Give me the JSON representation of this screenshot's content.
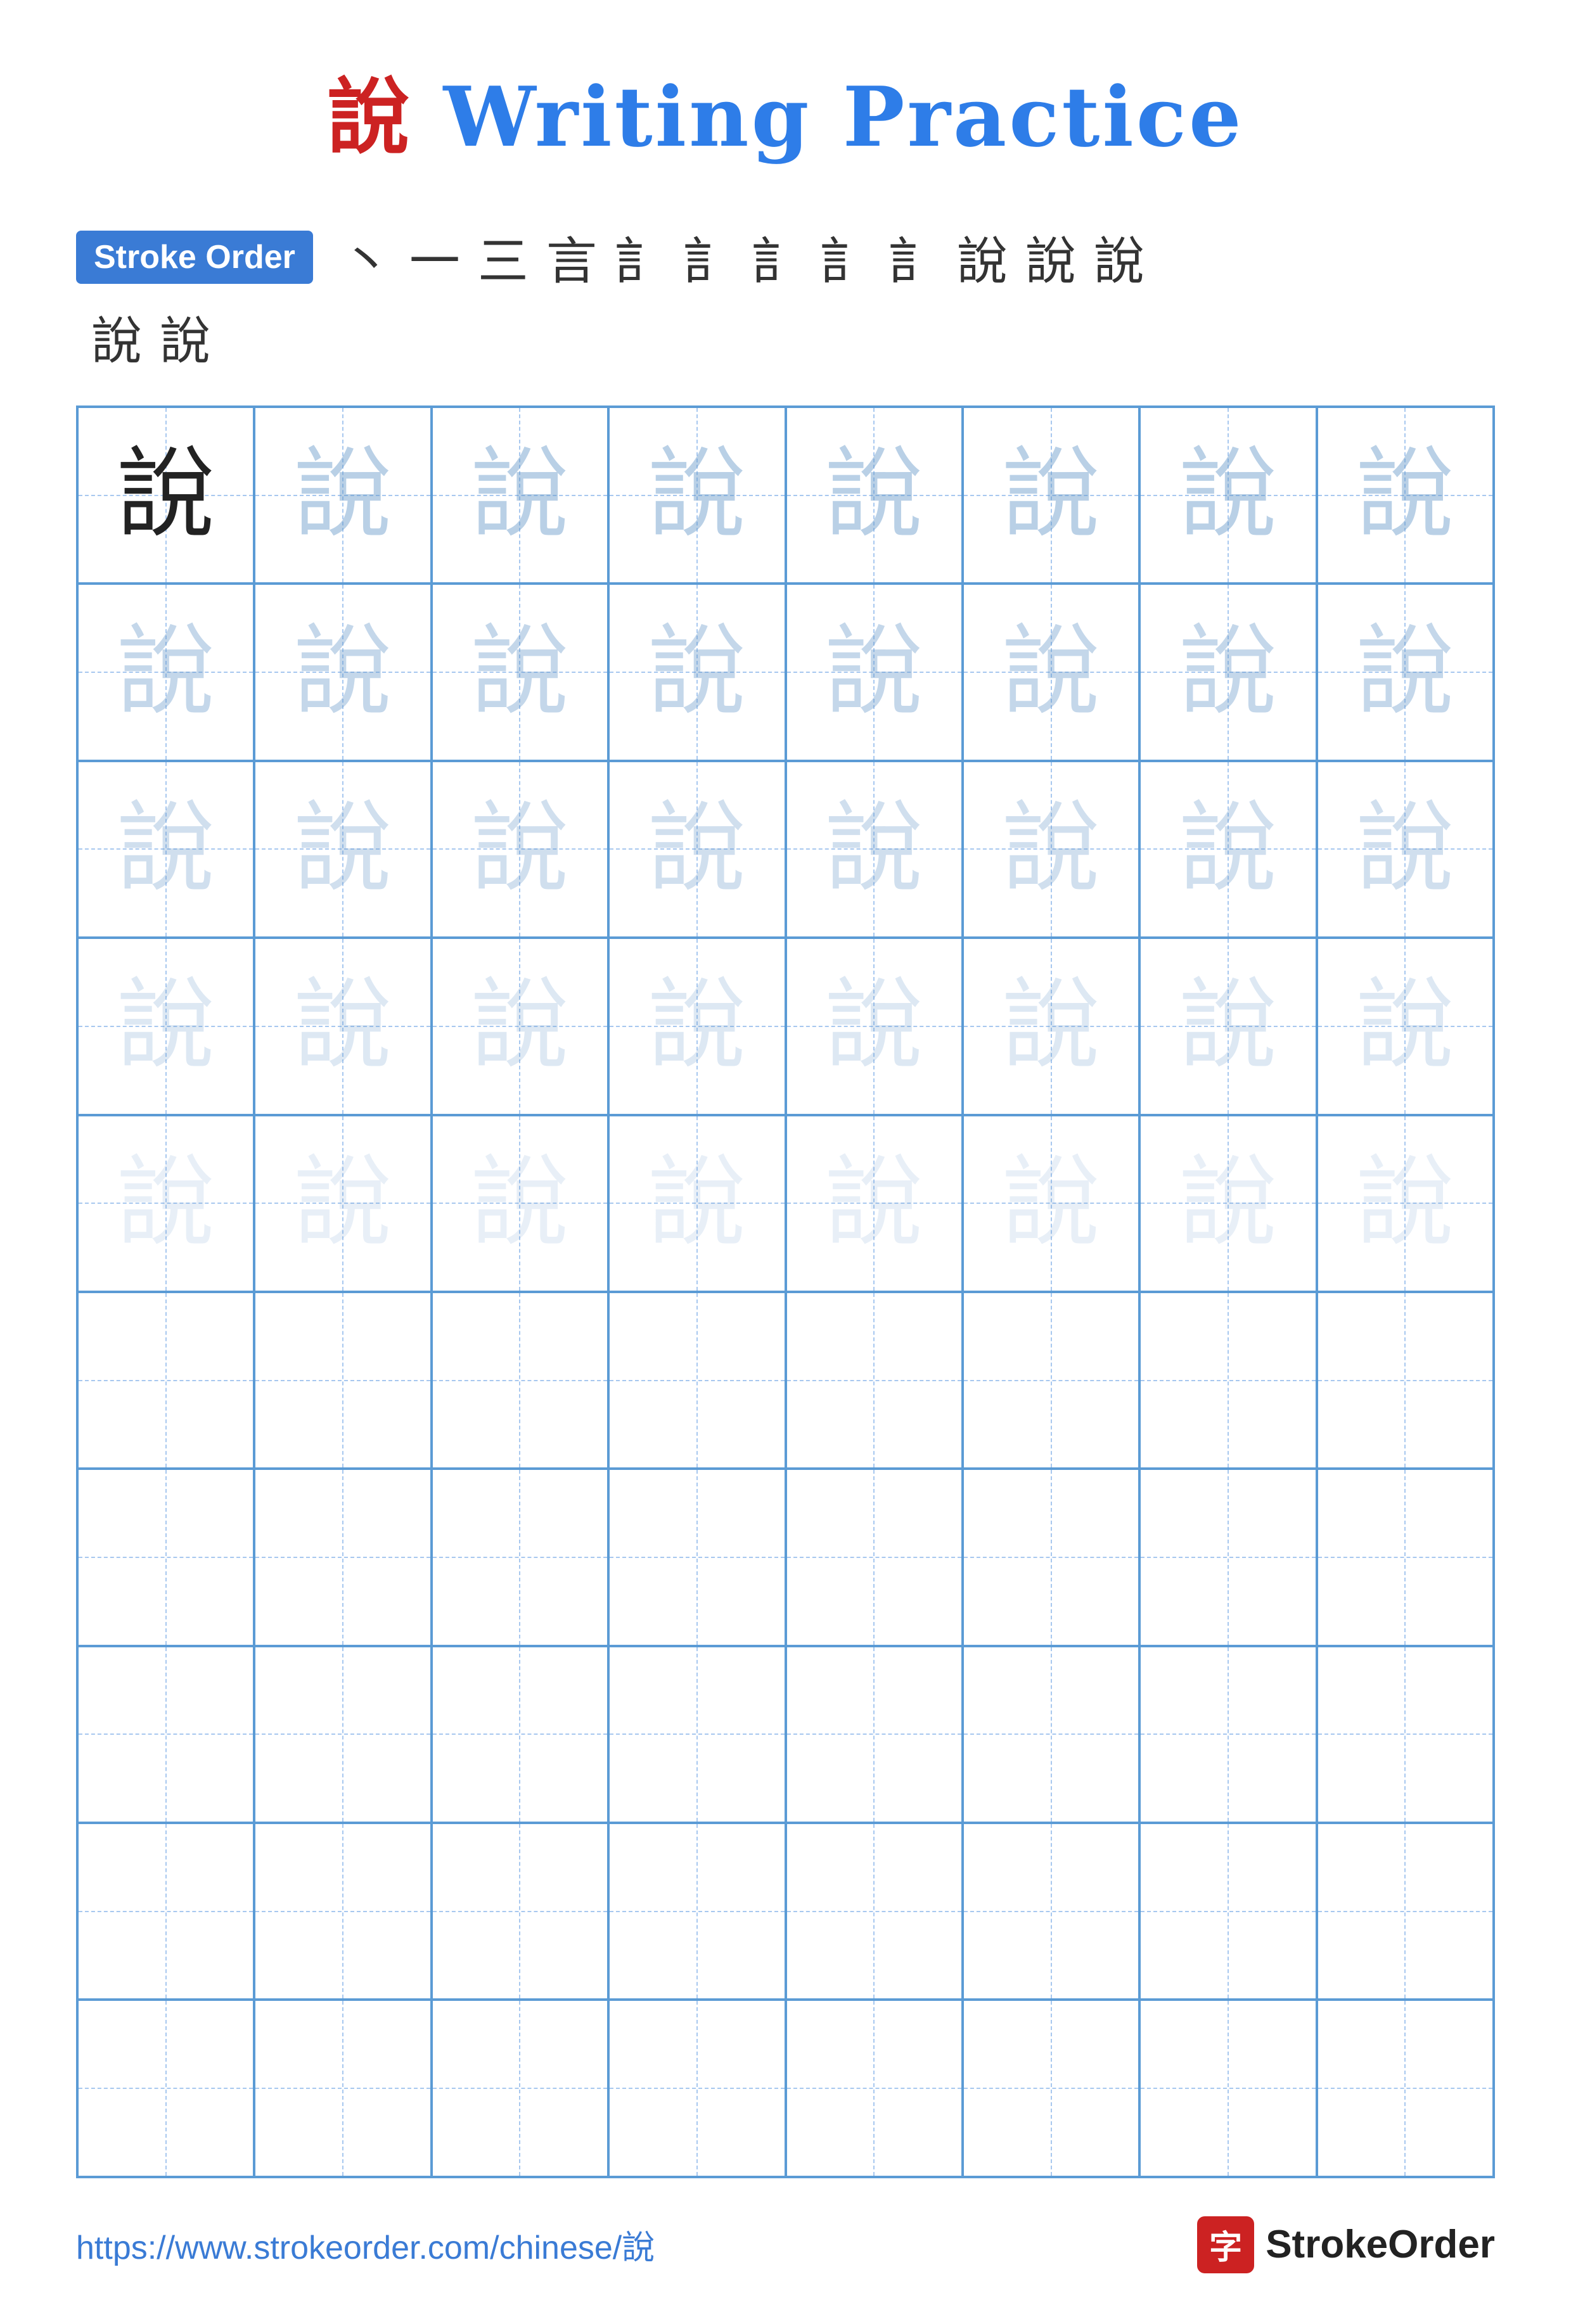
{
  "title": {
    "text": " Writing Practice",
    "kanji": "說"
  },
  "stroke_order": {
    "badge_label": "Stroke Order",
    "strokes_line1": [
      "丶",
      "ㄧ",
      "三",
      "言",
      "訁",
      "訁",
      "訁",
      "訁",
      "訁",
      "說",
      "說",
      "說"
    ],
    "strokes_line2": [
      "說",
      "說"
    ]
  },
  "grid": {
    "rows": 10,
    "cols": 8,
    "char": "說",
    "practice_rows": 5,
    "empty_rows": 5
  },
  "footer": {
    "url": "https://www.strokeorder.com/chinese/說",
    "logo_char": "字",
    "logo_text": "StrokeOrder"
  }
}
